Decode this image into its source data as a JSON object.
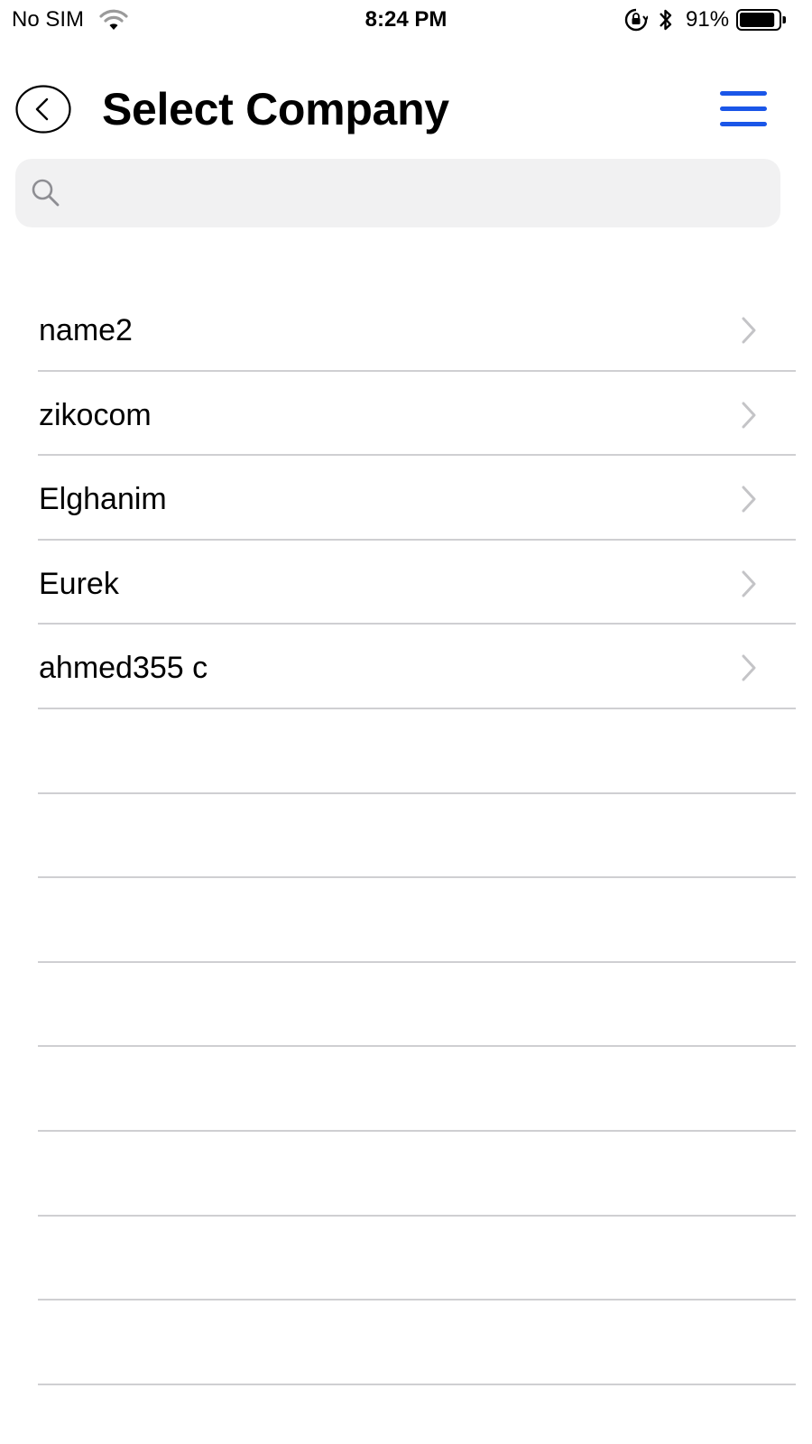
{
  "status_bar": {
    "carrier": "No SIM",
    "time": "8:24 PM",
    "battery_percent": "91%",
    "battery_level": 0.91,
    "icons": [
      "wifi-icon",
      "orientation-lock-icon",
      "bluetooth-icon",
      "battery-icon"
    ]
  },
  "header": {
    "title": "Select Company",
    "back_icon": "back-circle-icon",
    "menu_icon": "hamburger-menu-icon",
    "menu_color": "#1a56e8"
  },
  "search": {
    "placeholder": "",
    "value": "",
    "icon": "search-icon"
  },
  "companies": [
    {
      "name": "name2"
    },
    {
      "name": "zikocom"
    },
    {
      "name": "Elghanim"
    },
    {
      "name": "Eurek"
    },
    {
      "name": "ahmed355 c"
    }
  ],
  "empty_row_count": 8,
  "colors": {
    "separator": "#cfcfd2",
    "chevron": "#c4c4c7",
    "search_bg": "#f1f1f2"
  }
}
